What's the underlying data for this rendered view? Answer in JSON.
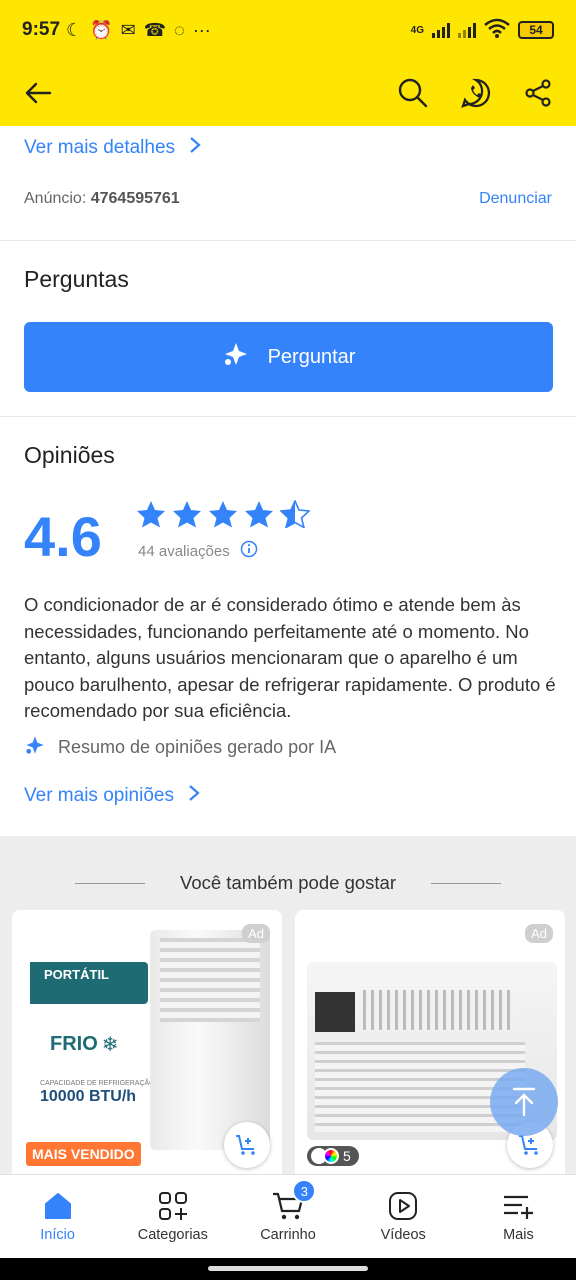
{
  "status": {
    "time": "9:57",
    "network": "4G",
    "battery": "54",
    "more": "···"
  },
  "page": {
    "details_link": "Ver mais detalhes",
    "anuncio_label": "Anúncio:",
    "anuncio_id": "4764595761",
    "report": "Denunciar",
    "questions_title": "Perguntas",
    "ask_button": "Perguntar",
    "opinions_title": "Opiniões",
    "rating": "4.6",
    "rating_value": 4.6,
    "reviews_count": "44 avaliações",
    "summary": "O condicionador de ar é considerado ótimo e atende bem às necessidades, funcionando perfeitamente até o momento. No entanto, alguns usuários mencionaram que o aparelho é um pouco barulhento, apesar de refrigerar rapidamente. O produto é recomendado por sua eficiência.",
    "ai_note": "Resumo de opiniões gerado por IA",
    "more_opinions": "Ver mais opiniões"
  },
  "recommendations": {
    "title": "Você também pode gostar",
    "cards": [
      {
        "ad": "Ad",
        "label_portatil": "PORTÁTIL",
        "label_frio": "FRIO",
        "capacity_caption": "CAPACIDADE DE REFRIGERAÇÃO",
        "capacity": "10000 BTU/h",
        "badge": "MAIS VENDIDO"
      },
      {
        "ad": "Ad",
        "colors": "5"
      }
    ]
  },
  "nav": {
    "items": [
      {
        "label": "Início",
        "icon": "home-icon"
      },
      {
        "label": "Categorias",
        "icon": "categories-icon"
      },
      {
        "label": "Carrinho",
        "icon": "cart-icon",
        "badge": "3"
      },
      {
        "label": "Vídeos",
        "icon": "video-icon"
      },
      {
        "label": "Mais",
        "icon": "menu-plus-icon"
      }
    ]
  },
  "colors": {
    "accent": "#3483fa",
    "header": "#fee600",
    "best_seller": "#ff7733"
  }
}
